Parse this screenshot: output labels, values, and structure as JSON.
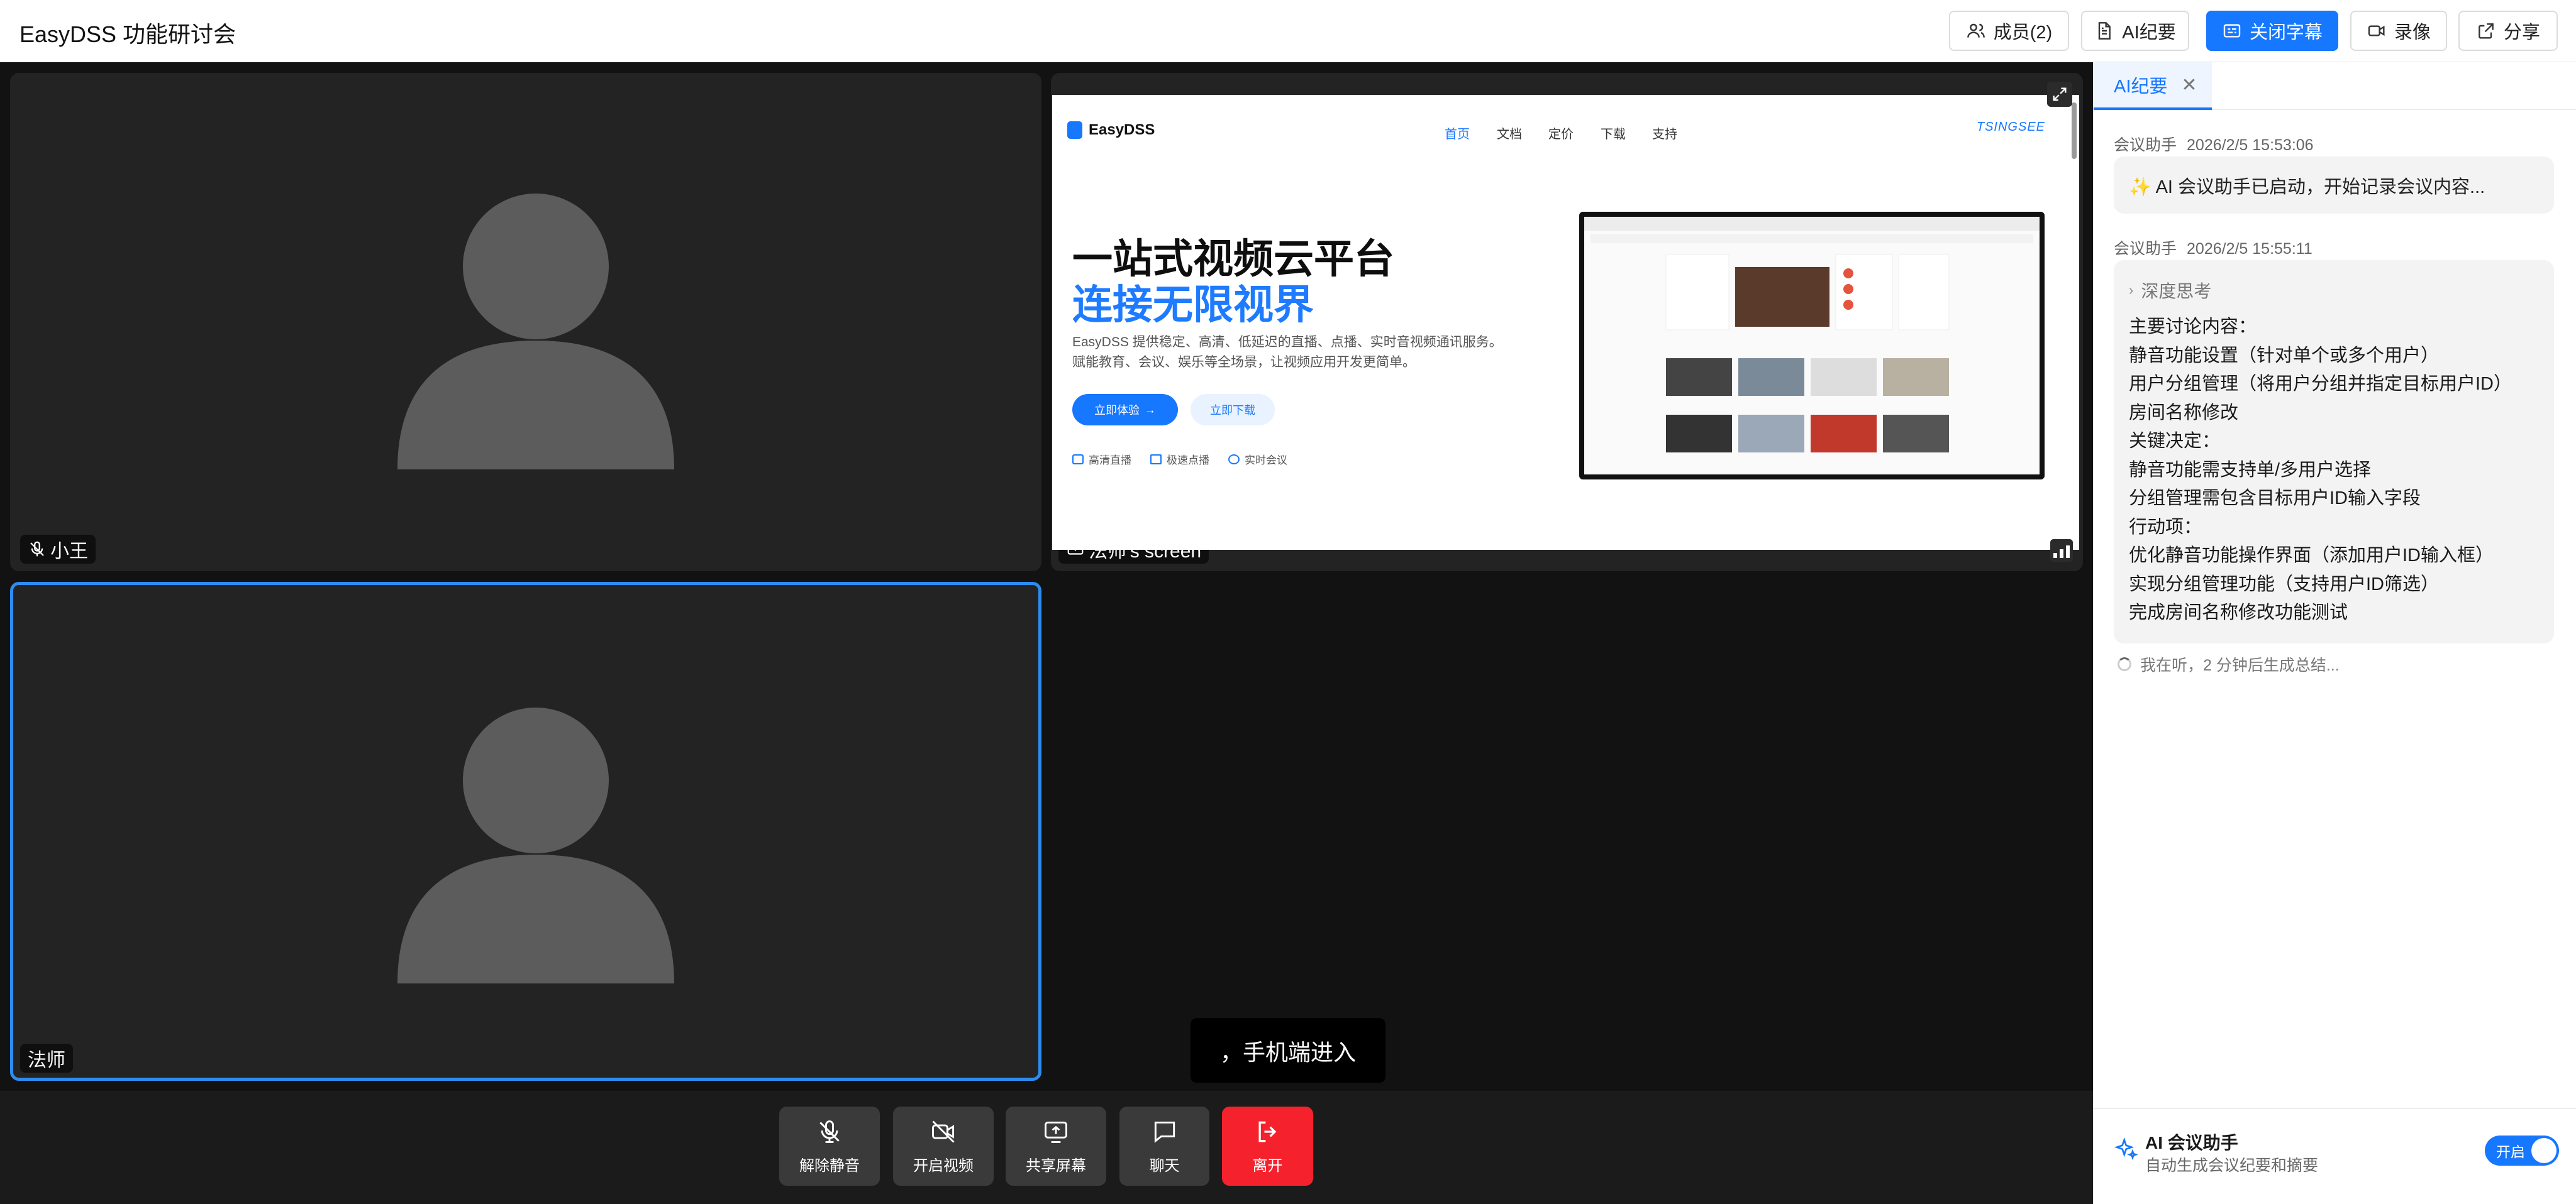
{
  "app": {
    "title": "EasyDSS 功能研讨会"
  },
  "toolbar": {
    "members_label": "成员(2)",
    "ai_minutes_label": "AI纪要",
    "captions_label": "关闭字幕",
    "record_label": "录像",
    "share_label": "分享"
  },
  "tiles": {
    "xiaowang": {
      "name": "小王",
      "mic": "muted"
    },
    "screen_share": {
      "label": "法师's screen"
    },
    "fashi": {
      "name": "法师",
      "active": true
    }
  },
  "shared_page": {
    "logo": "EasyDSS",
    "nav": [
      "首页",
      "文档",
      "定价",
      "下载",
      "支持"
    ],
    "brand": "TSINGSEE",
    "headline_1": "一站式视频云平台",
    "headline_2": "连接无限视界",
    "desc_1": "EasyDSS 提供稳定、高清、低延迟的直播、点播、实时音视频通讯服务。",
    "desc_2": "赋能教育、会议、娱乐等全场景，让视频应用开发更简单。",
    "cta_primary": "立即体验",
    "cta_secondary": "立即下载",
    "features": [
      "高清直播",
      "极速点播",
      "实时会议"
    ]
  },
  "caption": {
    "text": "，手机端进入"
  },
  "controls": {
    "unmute": "解除静音",
    "video": "开启视频",
    "share": "共享屏幕",
    "chat": "聊天",
    "leave": "离开"
  },
  "panel": {
    "tab_label": "AI纪要",
    "messages": [
      {
        "author": "会议助手",
        "time": "2026/2/5 15:53:06",
        "text": "✨ AI 会议助手已启动，开始记录会议内容..."
      },
      {
        "author": "会议助手",
        "time": "2026/2/5 15:55:11",
        "think_label": "深度思考",
        "lines": [
          "主要讨论内容：",
          "静音功能设置（针对单个或多个用户）",
          "用户分组管理（将用户分组并指定目标用户ID）",
          "房间名称修改",
          "关键决定：",
          "静音功能需支持单/多用户选择",
          "分组管理需包含目标用户ID输入字段",
          "行动项：",
          "优化静音功能操作界面（添加用户ID输入框）",
          "实现分组管理功能（支持用户ID筛选）",
          "完成房间名称修改功能测试"
        ]
      }
    ],
    "listening": "我在听，2 分钟后生成总结...",
    "assistant": {
      "title": "AI 会议助手",
      "subtitle": "自动生成会议纪要和摘要",
      "toggle_label": "开启",
      "enabled": true
    }
  },
  "colors": {
    "accent": "#1677ff",
    "leave": "#f5222d",
    "stage": "#121212",
    "tile": "#232323"
  }
}
